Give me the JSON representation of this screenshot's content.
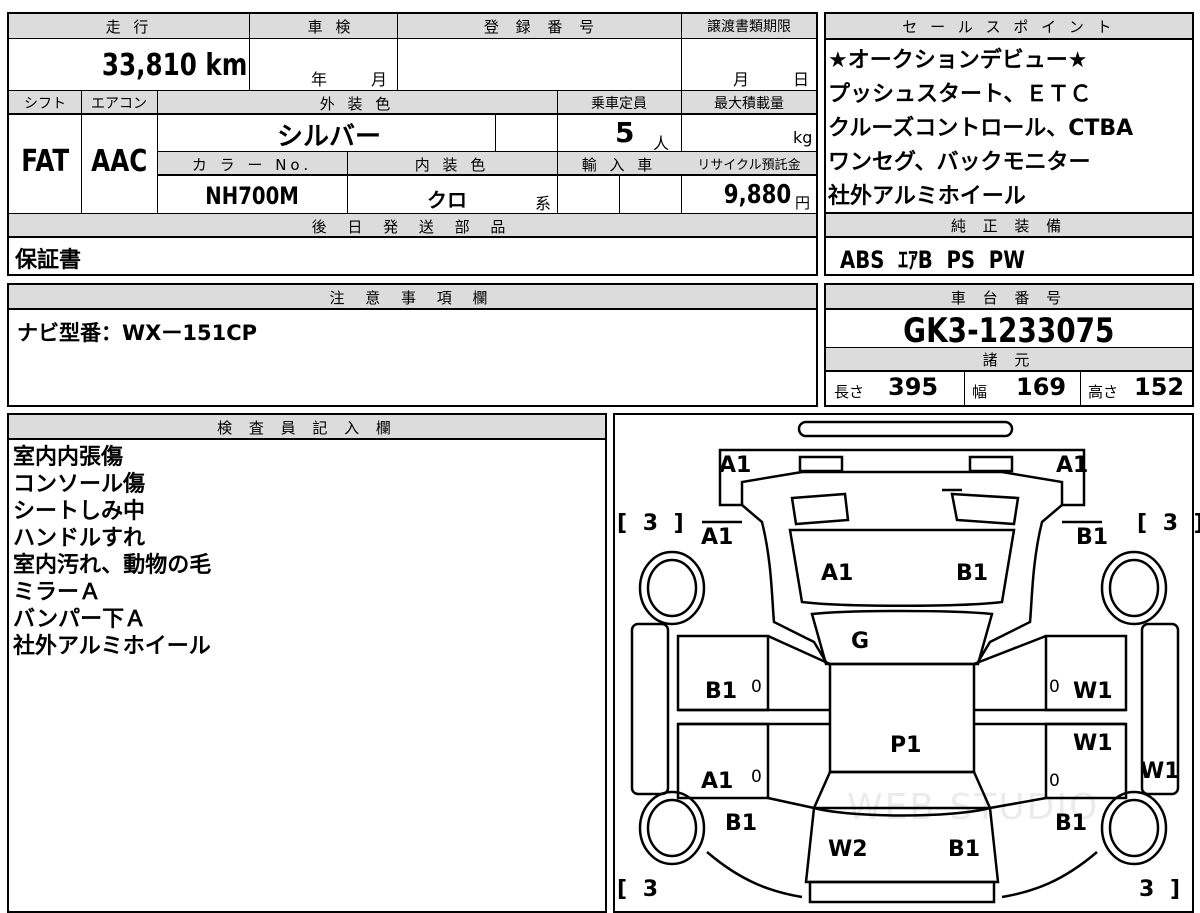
{
  "top": {
    "mileage_label": "走 行",
    "mileage_value": "33,810 km",
    "inspection_label": "車 検",
    "inspection_year": "年",
    "inspection_month": "月",
    "registration_label": "登 録 番 号",
    "registration_value": "",
    "transfer_label": "譲渡書類期限",
    "transfer_month": "月",
    "transfer_day": "日",
    "shift_label": "シフト",
    "aircon_label": "エアコン",
    "exterior_label": "外 装 色",
    "capacity_label": "乗車定員",
    "maxload_label": "最大積載量",
    "shift_value": "FAT",
    "aircon_value": "AAC",
    "exterior_value": "シルバー",
    "capacity_value": "5",
    "capacity_unit": "人",
    "maxload_unit": "kg",
    "color_no_label": "カ ラ ー No.",
    "interior_label": "内 装 色",
    "import_label": "輸 入 車",
    "recycle_label": "リサイクル預託金",
    "color_no_value": "NH700M",
    "interior_value": "クロ",
    "interior_suffix": "系",
    "recycle_value": "9,880",
    "recycle_unit": "円",
    "later_parts_label": "後 日 発 送 部 品",
    "later_parts_value": "保証書"
  },
  "sales": {
    "label": "セ ー ル ス ポ イ ン ト",
    "points": [
      "★オークションデビュー★",
      "プッシュスタート、ＥＴＣ",
      "クルーズコントロール、CTBA",
      "ワンセグ、バックモニター",
      "社外アルミホイール"
    ],
    "genuine_label": "純 正 装 備",
    "genuine_value": "ABS  ｴｱB  PS  PW"
  },
  "notes": {
    "label": "注 意 事 項 欄",
    "value": "ナビ型番：WXー151CP"
  },
  "chassis": {
    "label": "車 台 番 号",
    "value": "GK3-1233075",
    "spec_label": "諸 元",
    "length_label": "長さ",
    "length_value": "395",
    "width_label": "幅",
    "width_value": "169",
    "height_label": "高さ",
    "height_value": "152"
  },
  "inspector": {
    "label": "検 査 員 記 入 欄",
    "lines": [
      "室内内張傷",
      "コンソール傷",
      "シートしみ中",
      "ハンドルすれ",
      "室内汚れ、動物の毛",
      "ミラーＡ",
      "バンパー下Ａ",
      "社外アルミホイール"
    ]
  },
  "diagram": {
    "codes": {
      "front_left": "A1",
      "front_right": "A1",
      "fender_left": "A1",
      "fender_right": "B1",
      "hood_left": "A1",
      "hood_right": "B1",
      "windshield": "G",
      "door_fl": "B1",
      "door_fr": "W1",
      "roof": "P1",
      "door_rr": "W1",
      "door_rl": "A1",
      "side_right": "W1",
      "quarter_left": "B1",
      "quarter_right": "B1",
      "rear_left": "W2",
      "rear_right": "B1"
    },
    "zeros": [
      "0",
      "0",
      "0",
      "0"
    ],
    "tire_marks": [
      "[ 3 ]",
      "[ 3 ]",
      "[ 3",
      "3 ]"
    ],
    "watermark": "WEB STUDIO"
  }
}
